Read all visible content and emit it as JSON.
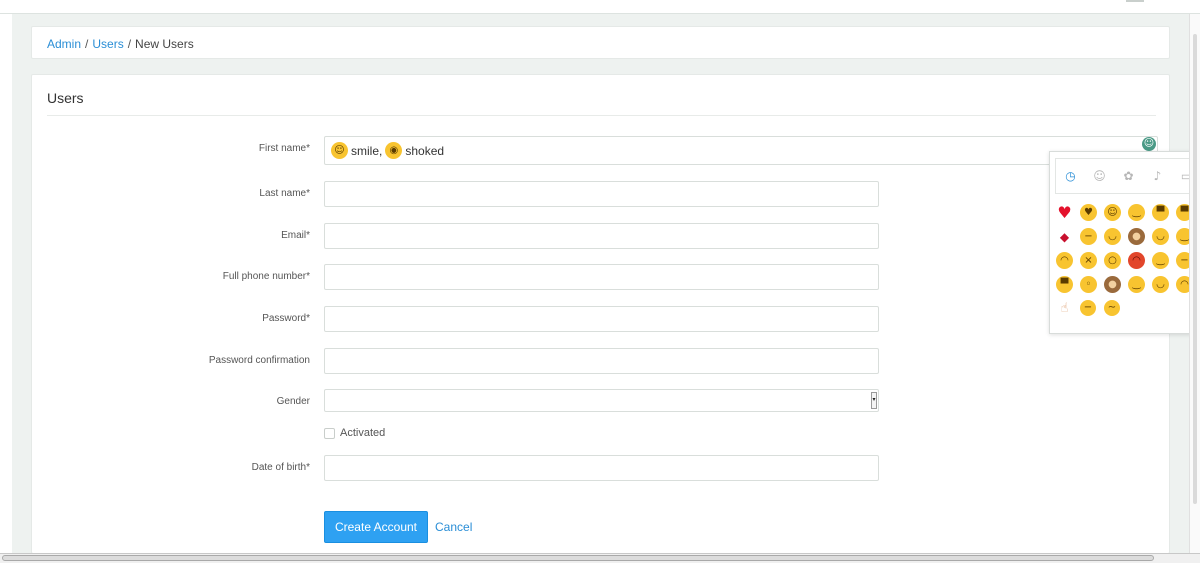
{
  "breadcrumb": {
    "admin": "Admin",
    "separator": "/",
    "users": "Users",
    "current": "New Users"
  },
  "card": {
    "title": "Users"
  },
  "form": {
    "first_name": {
      "label": "First name*",
      "value_parts": [
        {
          "icon": "smile-emoji-icon",
          "text": "smile,"
        },
        {
          "icon": "flushed-emoji-icon",
          "text": "shoked"
        }
      ]
    },
    "last_name": {
      "label": "Last name*",
      "value": ""
    },
    "email": {
      "label": "Email*",
      "value": ""
    },
    "phone": {
      "label": "Full phone number*",
      "value": ""
    },
    "password": {
      "label": "Password*",
      "value": ""
    },
    "password_confirmation": {
      "label": "Password confirmation",
      "value": ""
    },
    "gender": {
      "label": "Gender",
      "value": ""
    },
    "activated": {
      "label": "Activated",
      "checked": false
    },
    "date_of_birth": {
      "label": "Date of birth*",
      "value": ""
    },
    "submit_label": "Create Account",
    "cancel_label": "Cancel"
  },
  "emoji_picker": {
    "tabs": [
      {
        "icon": "clock-icon",
        "active": true
      },
      {
        "icon": "smiley-outline-icon",
        "active": false
      },
      {
        "icon": "flower-icon",
        "active": false
      },
      {
        "icon": "bell-icon",
        "active": false
      },
      {
        "icon": "car-icon",
        "active": false
      }
    ],
    "recent": [
      "heart",
      "heart-eyes",
      "blush",
      "relieved",
      "grin",
      "grinning-sweat",
      "kiss-lips",
      "unamused",
      "tongue-wink",
      "see-no-evil-monkey",
      "wink",
      "smirk",
      "crying",
      "squint-tongue",
      "scream",
      "angry",
      "smirk-side",
      "expressionless",
      "sweat-smile",
      "kissing-closed",
      "monkey-face",
      "relaxed",
      "smiley",
      "pensive",
      "pointing-up-hand",
      "neutral",
      "confused"
    ]
  },
  "colors": {
    "accent": "#2ea1f2",
    "link": "#2a8ed6",
    "emoji_toggle": "#4a9a86",
    "background": "#eef2f0"
  }
}
